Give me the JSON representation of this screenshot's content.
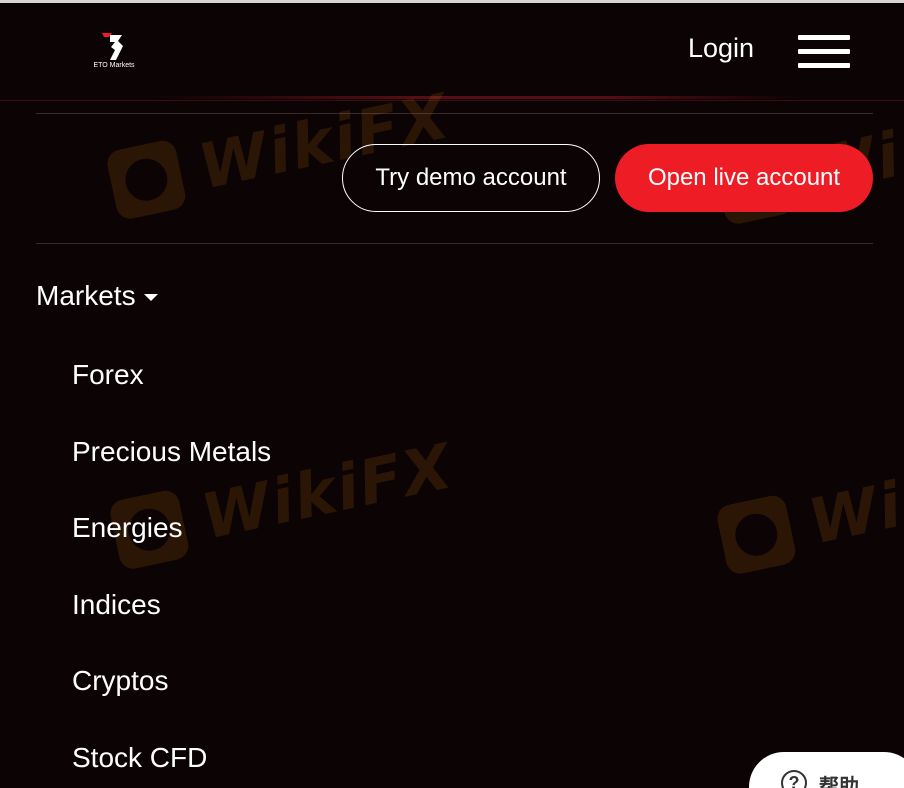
{
  "header": {
    "logo_text": "ETO Markets",
    "login_label": "Login",
    "menu_icon": "hamburger-menu-icon"
  },
  "cta": {
    "demo_label": "Try demo account",
    "live_label": "Open live account",
    "live_color": "#ee1c25"
  },
  "nav": {
    "markets_label": "Markets",
    "markets_items": [
      {
        "label": "Forex"
      },
      {
        "label": "Precious Metals"
      },
      {
        "label": "Energies"
      },
      {
        "label": "Indices"
      },
      {
        "label": "Cryptos"
      },
      {
        "label": "Stock CFD"
      }
    ]
  },
  "watermark": {
    "text": "WikiFX"
  },
  "help_widget": {
    "label": "帮助",
    "icon": "question-icon",
    "glyph": "?"
  },
  "colors": {
    "background": "#0c0305",
    "accent": "#ee1c25",
    "text": "#ffffff"
  }
}
